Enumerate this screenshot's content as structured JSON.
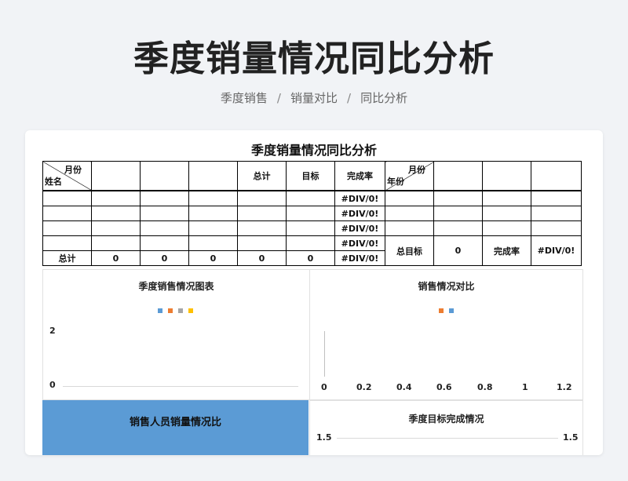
{
  "page": {
    "title": "季度销量情况同比分析",
    "breadcrumb": [
      "季度销售",
      "销量对比",
      "同比分析"
    ]
  },
  "sheet": {
    "title": "季度销量情况同比分析",
    "header": {
      "corner_top": "月份",
      "corner_bottom": "姓名",
      "total": "总计",
      "target": "目标",
      "rate": "完成率",
      "corner2_top": "月份",
      "corner2_bottom": "年份"
    },
    "div_error": "#DIV/0!",
    "total_row": {
      "label": "总计",
      "values": [
        "0",
        "0",
        "0",
        "0",
        "0"
      ],
      "rate": "#DIV/0!"
    },
    "side": {
      "total_target_label": "总目标",
      "total_target_value": "0",
      "rate_label": "完成率",
      "rate_value": "#DIV/0!"
    }
  },
  "charts": {
    "quarter_sales": {
      "title": "季度销售情况图表",
      "legend_colors": [
        "#5b9bd5",
        "#ed7d31",
        "#a5a5a5",
        "#ffc000"
      ],
      "y_ticks": [
        "2",
        "0"
      ]
    },
    "sales_compare": {
      "title": "销售情况对比",
      "legend_colors": [
        "#ed7d31",
        "#5b9bd5"
      ],
      "x_ticks": [
        "0",
        "0.2",
        "0.4",
        "0.6",
        "0.8",
        "1",
        "1.2"
      ]
    },
    "staff_sales": {
      "title": "销售人员销量情况比",
      "background": "#5b9bd5"
    },
    "quarter_target": {
      "title": "季度目标完成情况",
      "y_left": "1.5",
      "y_right": "1.5"
    }
  }
}
